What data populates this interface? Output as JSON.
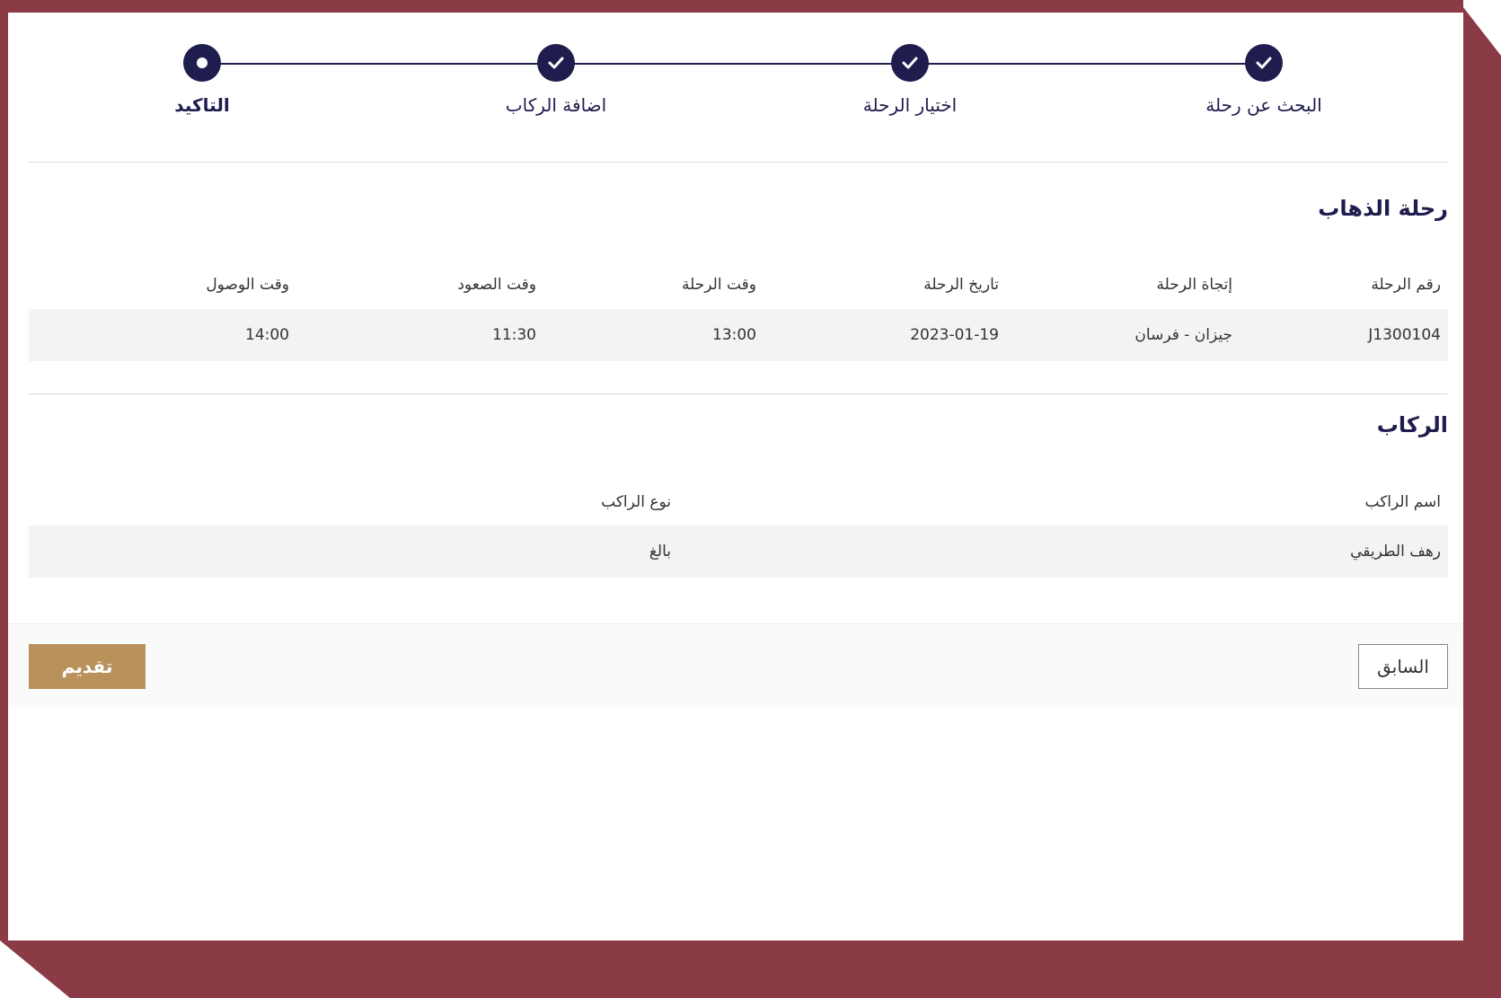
{
  "colors": {
    "frame": "#8a3b45",
    "stepper": "#1f1d4d",
    "submit": "#b8925a",
    "row_bg": "#f3f3f3"
  },
  "stepper": {
    "steps": [
      {
        "label": "البحث عن رحلة",
        "state": "done",
        "icon": "check-icon"
      },
      {
        "label": "اختيار الرحلة",
        "state": "done",
        "icon": "check-icon"
      },
      {
        "label": "اضافة الركاب",
        "state": "done",
        "icon": "check-icon"
      },
      {
        "label": "التاكيد",
        "state": "current",
        "icon": "current-dot-icon"
      }
    ]
  },
  "departure": {
    "title": "رحلة الذهاب",
    "columns": [
      "رقم الرحلة",
      "إتجاة الرحلة",
      "تاريخ الرحلة",
      "وقت الرحلة",
      "وقت الصعود",
      "وقت الوصول"
    ],
    "row": [
      "J1300104",
      "جيزان - فرسان",
      "2023-01-19",
      "13:00",
      "11:30",
      "14:00"
    ]
  },
  "passengers": {
    "title": "الركاب",
    "columns": [
      "اسم الراكب",
      "نوع الراكب"
    ],
    "row": [
      "رهف الطريقي",
      "بالغ"
    ]
  },
  "actions": {
    "previous_label": "السابق",
    "submit_label": "تقديم"
  }
}
